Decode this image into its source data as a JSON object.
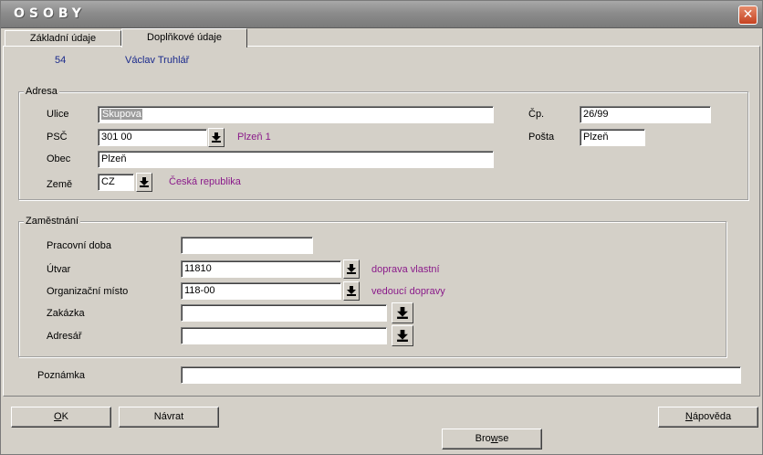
{
  "window": {
    "title": "OSOBY",
    "close_glyph": "✕"
  },
  "tabs": [
    {
      "label": "Základní údaje",
      "active": false
    },
    {
      "label": "Doplňkové údaje",
      "active": true
    }
  ],
  "person": {
    "id": "54",
    "name": "Václav Truhlář"
  },
  "address": {
    "legend": "Adresa",
    "street_label": "Ulice",
    "street_value": "Skupova",
    "zip_label": "PSČ",
    "zip_value": "301 00",
    "zip_lookup": "Plzeň 1",
    "city_label": "Obec",
    "city_value": "Plzeň",
    "country_label": "Země",
    "country_value": "CZ",
    "country_lookup": "Česká republika",
    "house_no_label": "Čp.",
    "house_no_value": "26/99",
    "post_label": "Pošta",
    "post_value": "Plzeň"
  },
  "employment": {
    "legend": "Zaměstnání",
    "hours_label": "Pracovní doba",
    "hours_value": "",
    "dept_label": "Útvar",
    "dept_value": "11810",
    "dept_lookup": "doprava vlastní",
    "position_label": "Organizační místo",
    "position_value": "118-00",
    "position_lookup": "vedoucí dopravy",
    "order_label": "Zakázka",
    "order_value": "",
    "directory_label": "Adresář",
    "directory_value": ""
  },
  "note": {
    "label": "Poznámka",
    "value": ""
  },
  "buttons": {
    "ok": {
      "label_u": "O",
      "label_rest": "K"
    },
    "back": {
      "label": "Návrat"
    },
    "help": {
      "label_u": "N",
      "label_rest": "ápověda"
    },
    "browse": {
      "label_pre": "Bro",
      "label_u": "w",
      "label_post": "se"
    }
  },
  "icons": {
    "dropdown": "download-arrow-icon",
    "close": "close-icon"
  }
}
